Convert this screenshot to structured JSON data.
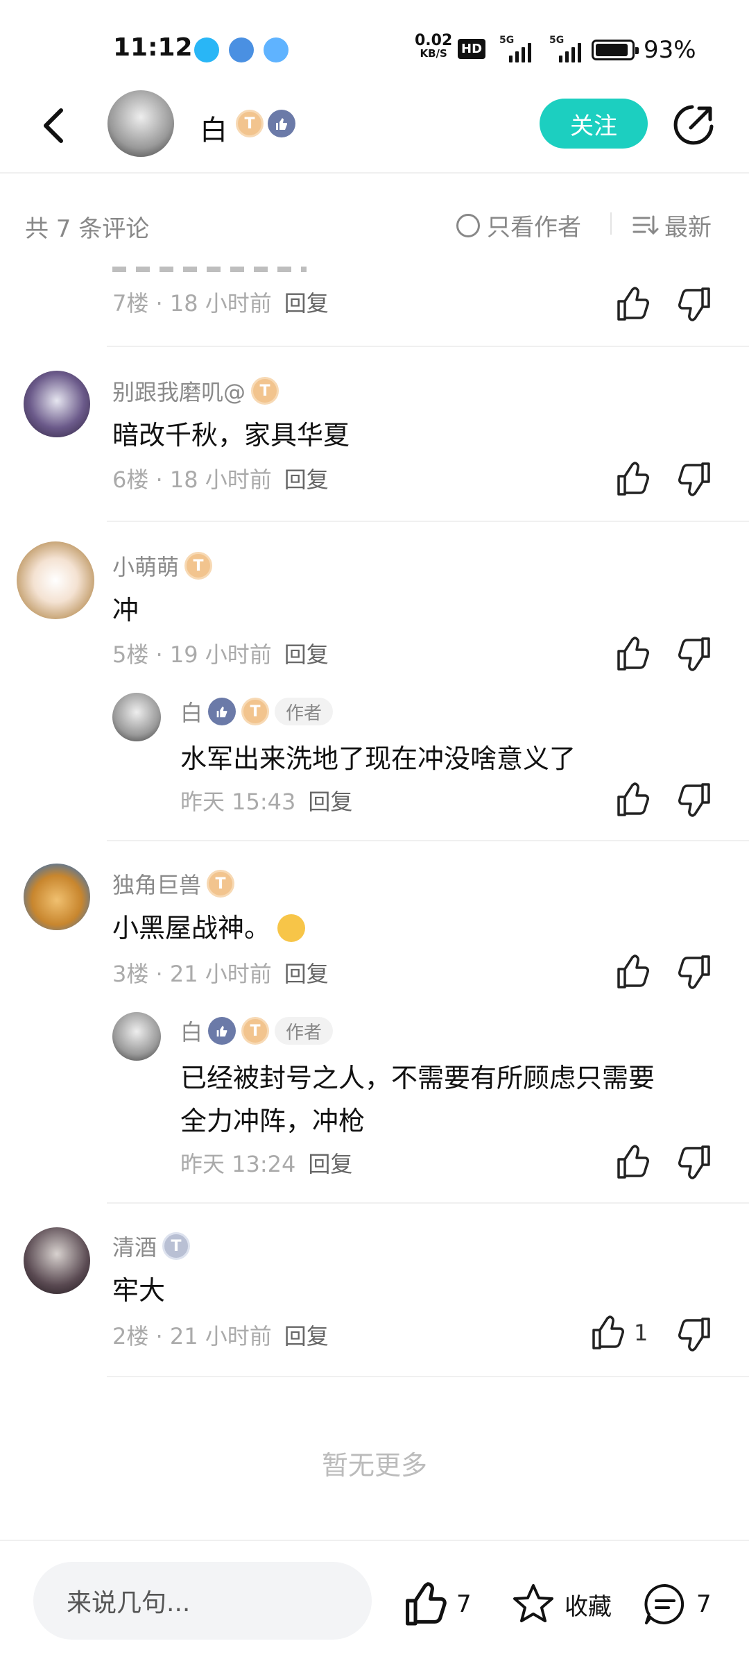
{
  "status_bar": {
    "time": "11:12",
    "speed": "0.02",
    "speed_unit": "KB/S",
    "hd": "HD",
    "net1": "5G",
    "net2": "5G",
    "battery": "93%"
  },
  "header": {
    "username": "白",
    "badge_level": "T",
    "follow_label": "关注"
  },
  "toolbar": {
    "count_label": "共 7 条评论",
    "only_author_label": "只看作者",
    "sort_label": "最新"
  },
  "comments": [
    {
      "meta": "7楼 · 18 小时前",
      "reply": "回复"
    },
    {
      "name": "别跟我磨叽@",
      "badge": "T",
      "text": "暗改千秋，家具华夏",
      "meta": "6楼 · 18 小时前",
      "reply": "回复"
    },
    {
      "name": "小萌萌",
      "badge": "T",
      "text": "冲",
      "meta": "5楼 · 19 小时前",
      "reply": "回复",
      "sub": {
        "name": "白",
        "author_tag": "作者",
        "text": "水军出来洗地了现在冲没啥意义了",
        "meta": "昨天 15:43",
        "reply": "回复"
      }
    },
    {
      "name": "独角巨兽",
      "badge": "T",
      "text": "小黑屋战神。",
      "meta": "3楼 · 21 小时前",
      "reply": "回复",
      "sub": {
        "name": "白",
        "author_tag": "作者",
        "text_line1": "已经被封号之人，不需要有所顾虑只需要",
        "text_line2": "全力冲阵，冲枪",
        "meta": "昨天 13:24",
        "reply": "回复"
      }
    },
    {
      "name": "清酒",
      "badge": "T",
      "text": "牢大",
      "meta": "2楼 · 21 小时前",
      "reply": "回复",
      "likes": "1"
    }
  ],
  "no_more": "暂无更多",
  "bottom": {
    "input_placeholder": "来说几句...",
    "likes": "7",
    "collect_label": "收藏",
    "comments": "7"
  },
  "colors": {
    "accent": "#1ccfc0",
    "badge": "#f2c48e",
    "like_badge": "#6b7aa8"
  }
}
